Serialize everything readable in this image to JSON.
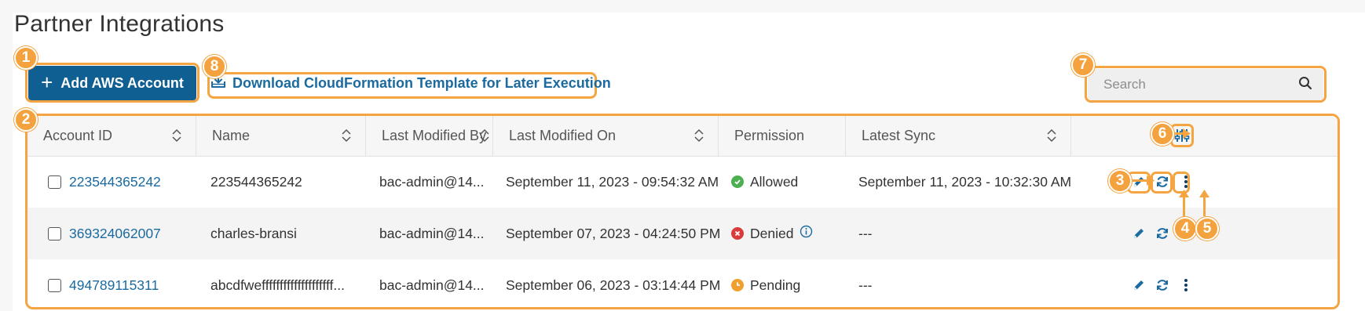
{
  "page": {
    "title": "Partner Integrations"
  },
  "toolbar": {
    "add_button_label": "Add AWS Account",
    "download_link_label": "Download CloudFormation Template for Later Execution",
    "search_placeholder": "Search"
  },
  "table": {
    "columns": [
      "Account ID",
      "Name",
      "Last Modified By",
      "Last Modified On",
      "Permission",
      "Latest Sync"
    ],
    "rows": [
      {
        "account_id": "223544365242",
        "name": "223544365242",
        "modified_by": "bac-admin@14...",
        "modified_on": "September 11, 2023 - 09:54:32 AM",
        "permission": "Allowed",
        "permission_status": "allowed",
        "latest_sync": "September 11, 2023 - 10:32:30 AM"
      },
      {
        "account_id": "369324062007",
        "name": "charles-bransi",
        "modified_by": "bac-admin@14...",
        "modified_on": "September 07, 2023 - 04:24:50 PM",
        "permission": "Denied",
        "permission_status": "denied",
        "latest_sync": "---"
      },
      {
        "account_id": "494789115311",
        "name": "abcdfweffffffffffffffffffff...",
        "modified_by": "bac-admin@14...",
        "modified_on": "September 06, 2023 - 03:14:44 PM",
        "permission": "Pending",
        "permission_status": "pending",
        "latest_sync": "---"
      }
    ]
  },
  "annotations": [
    "1",
    "2",
    "3",
    "4",
    "5",
    "6",
    "7",
    "8"
  ],
  "colors": {
    "accent_orange": "#f5a442",
    "primary_blue": "#0f5f92",
    "link_blue": "#1b6aa0",
    "allowed_green": "#4caf50",
    "denied_red": "#d93a3a",
    "pending_orange": "#f0a030"
  },
  "icons": {
    "add": "plus-icon",
    "download": "download-tray-icon",
    "search": "search-icon",
    "sort": "sort-icon",
    "column_settings": "sliders-icon",
    "edit": "pencil-icon",
    "sync": "refresh-icon",
    "more": "kebab-menu-icon",
    "info": "info-icon"
  }
}
